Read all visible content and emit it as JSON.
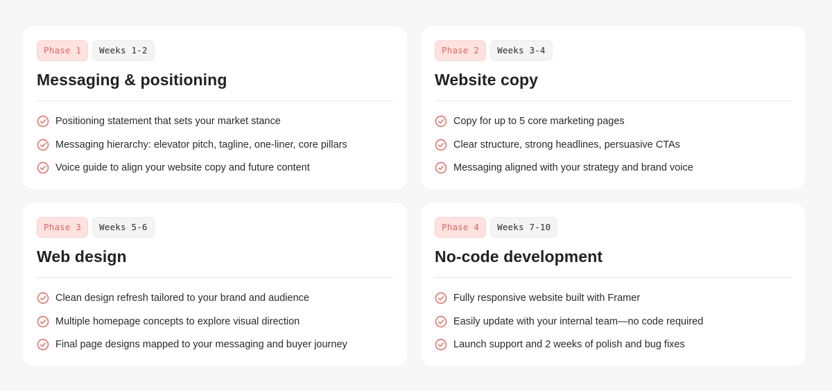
{
  "cards": [
    {
      "phase": "Phase 1",
      "weeks": "Weeks 1-2",
      "title": "Messaging & positioning",
      "items": [
        "Positioning statement that sets your market stance",
        "Messaging hierarchy: elevator pitch, tagline, one-liner, core pillars",
        "Voice guide to align your website copy and future content"
      ]
    },
    {
      "phase": "Phase 2",
      "weeks": "Weeks 3-4",
      "title": "Website copy",
      "items": [
        "Copy for up to 5 core marketing pages",
        "Clear structure, strong headlines, persuasive CTAs",
        "Messaging aligned with your strategy and brand voice"
      ]
    },
    {
      "phase": "Phase 3",
      "weeks": "Weeks 5-6",
      "title": "Web design",
      "items": [
        "Clean design refresh tailored to your brand and audience",
        "Multiple homepage concepts to explore visual direction",
        "Final page designs mapped to your messaging and buyer journey"
      ]
    },
    {
      "phase": "Phase 4",
      "weeks": "Weeks 7-10",
      "title": "No-code development",
      "items": [
        "Fully responsive website built with Framer",
        "Easily update with your internal team—no code required",
        "Launch support and 2 weeks of polish and bug fixes"
      ]
    }
  ],
  "colors": {
    "accent": "#e0675e",
    "phase_badge_bg": "#fde2e0",
    "card_bg": "#ffffff",
    "page_bg": "#f7f7f7"
  },
  "icons": {
    "check": "check-circle-icon"
  }
}
